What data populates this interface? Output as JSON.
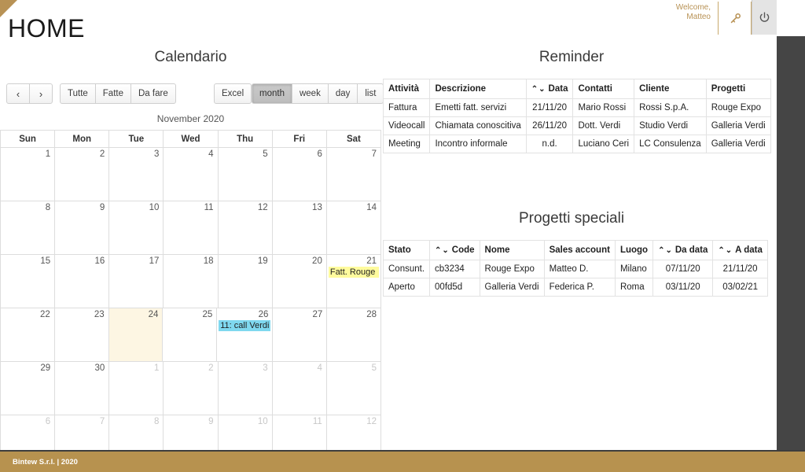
{
  "header": {
    "title": "HOME",
    "welcome_line1": "Welcome,",
    "welcome_line2": "Matteo",
    "key_icon": "key-icon",
    "power_icon": "power-icon"
  },
  "calendar": {
    "title": "Calendario",
    "nav": {
      "prev": "‹",
      "next": "›"
    },
    "filters": [
      "Tutte",
      "Fatte",
      "Da fare"
    ],
    "excel_label": "Excel",
    "views": [
      {
        "label": "month",
        "active": true
      },
      {
        "label": "week",
        "active": false
      },
      {
        "label": "day",
        "active": false
      },
      {
        "label": "list",
        "active": false
      }
    ],
    "month_label": "November 2020",
    "weekdays": [
      "Sun",
      "Mon",
      "Tue",
      "Wed",
      "Thu",
      "Fri",
      "Sat"
    ],
    "weeks": [
      [
        {
          "day": "1",
          "other": false
        },
        {
          "day": "2",
          "other": false
        },
        {
          "day": "3",
          "other": false
        },
        {
          "day": "4",
          "other": false
        },
        {
          "day": "5",
          "other": false
        },
        {
          "day": "6",
          "other": false
        },
        {
          "day": "7",
          "other": false
        }
      ],
      [
        {
          "day": "8",
          "other": false
        },
        {
          "day": "9",
          "other": false
        },
        {
          "day": "10",
          "other": false
        },
        {
          "day": "11",
          "other": false
        },
        {
          "day": "12",
          "other": false
        },
        {
          "day": "13",
          "other": false
        },
        {
          "day": "14",
          "other": false
        }
      ],
      [
        {
          "day": "15",
          "other": false
        },
        {
          "day": "16",
          "other": false
        },
        {
          "day": "17",
          "other": false
        },
        {
          "day": "18",
          "other": false
        },
        {
          "day": "19",
          "other": false
        },
        {
          "day": "20",
          "other": false
        },
        {
          "day": "21",
          "other": false,
          "event": {
            "text": "Fatt. Rouge",
            "color": "yellow"
          }
        }
      ],
      [
        {
          "day": "22",
          "other": false
        },
        {
          "day": "23",
          "other": false
        },
        {
          "day": "24",
          "other": false,
          "today": true
        },
        {
          "day": "25",
          "other": false
        },
        {
          "day": "26",
          "other": false,
          "event": {
            "text": "11: call Verdi",
            "color": "blue"
          }
        },
        {
          "day": "27",
          "other": false
        },
        {
          "day": "28",
          "other": false
        }
      ],
      [
        {
          "day": "29",
          "other": false
        },
        {
          "day": "30",
          "other": false
        },
        {
          "day": "1",
          "other": true
        },
        {
          "day": "2",
          "other": true
        },
        {
          "day": "3",
          "other": true
        },
        {
          "day": "4",
          "other": true
        },
        {
          "day": "5",
          "other": true
        }
      ],
      [
        {
          "day": "6",
          "other": true
        },
        {
          "day": "7",
          "other": true
        },
        {
          "day": "8",
          "other": true
        },
        {
          "day": "9",
          "other": true
        },
        {
          "day": "10",
          "other": true
        },
        {
          "day": "11",
          "other": true
        },
        {
          "day": "12",
          "other": true
        }
      ]
    ]
  },
  "reminder": {
    "title": "Reminder",
    "columns": [
      {
        "label": "Attività",
        "sortable": false
      },
      {
        "label": "Descrizione",
        "sortable": false
      },
      {
        "label": "Data",
        "sortable": true
      },
      {
        "label": "Contatti",
        "sortable": false
      },
      {
        "label": "Cliente",
        "sortable": false
      },
      {
        "label": "Progetti",
        "sortable": false
      }
    ],
    "rows": [
      [
        "Fattura",
        "Emetti fatt. servizi",
        "21/11/20",
        "Mario Rossi",
        "Rossi S.p.A.",
        "Rouge Expo"
      ],
      [
        "Videocall",
        "Chiamata conoscitiva",
        "26/11/20",
        "Dott. Verdi",
        "Studio Verdi",
        "Galleria Verdi"
      ],
      [
        "Meeting",
        "Incontro informale",
        "n.d.",
        "Luciano Ceri",
        "LC Consulenza",
        "Galleria Verdi"
      ]
    ]
  },
  "progetti": {
    "title": "Progetti speciali",
    "columns": [
      {
        "label": "Stato",
        "sortable": false
      },
      {
        "label": "Code",
        "sortable": true
      },
      {
        "label": "Nome",
        "sortable": false
      },
      {
        "label": "Sales account",
        "sortable": false
      },
      {
        "label": "Luogo",
        "sortable": false
      },
      {
        "label": "Da data",
        "sortable": true
      },
      {
        "label": "A data",
        "sortable": true
      }
    ],
    "rows": [
      [
        "Consunt.",
        "cb3234",
        "Rouge Expo",
        "Matteo D.",
        "Milano",
        "07/11/20",
        "21/11/20"
      ],
      [
        "Aperto",
        "00fd5d",
        "Galleria Verdi",
        "Federica P.",
        "Roma",
        "03/11/20",
        "03/02/21"
      ]
    ]
  },
  "footer": {
    "text": "Bintew S.r.l. | 2020"
  },
  "colors": {
    "accent_gold": "#b7924f",
    "rail_dark": "#454545",
    "event_yellow": "#fffb9d",
    "event_blue": "#7fd8ef",
    "today_bg": "#fdf6e3"
  }
}
